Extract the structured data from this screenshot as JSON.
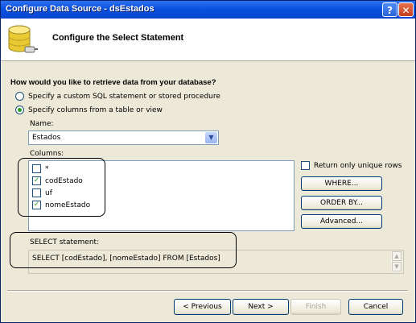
{
  "window": {
    "title": "Configure Data Source - dsEstados"
  },
  "header": {
    "title": "Configure the Select Statement"
  },
  "question": "How would you like to retrieve data from your database?",
  "options": {
    "custom": "Specify a custom SQL statement or stored procedure",
    "columns": "Specify columns from a table or view"
  },
  "name": {
    "label": "Name:",
    "value": "Estados"
  },
  "columns": {
    "label": "Columns:",
    "items": [
      {
        "label": "*",
        "checked": false
      },
      {
        "label": "codEstado",
        "checked": true
      },
      {
        "label": "uf",
        "checked": false
      },
      {
        "label": "nomeEstado",
        "checked": true
      }
    ]
  },
  "unique_rows": "Return only unique rows",
  "buttons": {
    "where": "WHERE...",
    "order_by": "ORDER BY...",
    "advanced": "Advanced...",
    "previous": "< Previous",
    "next": "Next >",
    "finish": "Finish",
    "cancel": "Cancel"
  },
  "select_statement": {
    "label": "SELECT statement:",
    "value": "SELECT [codEstado], [nomeEstado] FROM [Estados]"
  },
  "colors": {
    "titlebar": "#0a52e0",
    "dialog_bg": "#ece9d8",
    "check": "#21a121"
  }
}
